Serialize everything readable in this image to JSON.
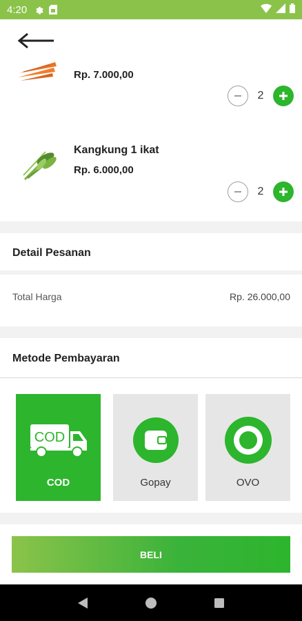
{
  "status_bar": {
    "time": "4:20",
    "icons": [
      "gear-icon",
      "sim-card-icon",
      "wifi-icon",
      "signal-icon",
      "battery-icon"
    ]
  },
  "cart": {
    "items": [
      {
        "name": "",
        "price": "Rp. 7.000,00",
        "qty": "2",
        "image": "carrot-image"
      },
      {
        "name": "Kangkung 1 ikat",
        "price": "Rp. 6.000,00",
        "qty": "2",
        "image": "kangkung-image"
      }
    ]
  },
  "order_detail": {
    "title": "Detail Pesanan",
    "total_label": "Total Harga",
    "total_value": "Rp. 26.000,00"
  },
  "payment": {
    "title": "Metode Pembayaran",
    "selected": "COD",
    "methods": [
      {
        "label": "COD",
        "icon": "cod-truck-icon"
      },
      {
        "label": "Gopay",
        "icon": "wallet-icon"
      },
      {
        "label": "OVO",
        "icon": "ovo-icon"
      }
    ]
  },
  "buy_button": {
    "label": "BELI"
  },
  "colors": {
    "status_bar": "#8bc34a",
    "accent": "#2db52d",
    "card_bg": "#e6e6e6"
  }
}
